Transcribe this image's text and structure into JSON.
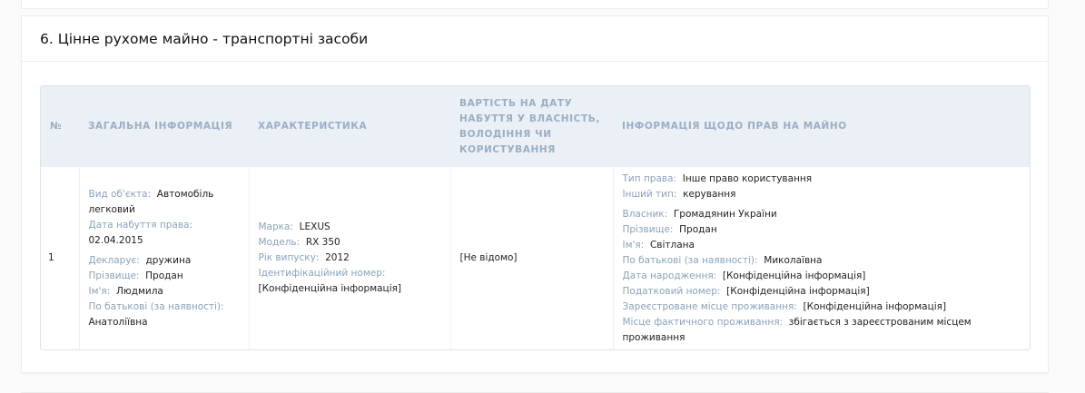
{
  "section": {
    "title": "6. Цінне рухоме майно - транспортні засоби"
  },
  "table": {
    "headers": {
      "no": "№",
      "general": "Загальна інформація",
      "characteristic": "Характеристика",
      "value": "Вартість на дату набуття у власність, володіння чи користування",
      "rights": "Інформація щодо прав на майно"
    },
    "row": {
      "no": "1",
      "general": {
        "object_type_label": "Вид об'єкта:",
        "object_type_value": "Автомобіль легковий",
        "acq_date_label": "Дата набуття права:",
        "acq_date_value": "02.04.2015",
        "declarant_label": "Декларує:",
        "declarant_value": "дружина",
        "surname_label": "Прізвище:",
        "surname_value": "Продан",
        "name_label": "Ім'я:",
        "name_value": "Людмила",
        "patronymic_label": "По батькові (за наявності):",
        "patronymic_value": "Анатоліївна"
      },
      "characteristic": {
        "brand_label": "Марка:",
        "brand_value": "LEXUS",
        "model_label": "Модель:",
        "model_value": "RX 350",
        "year_label": "Рік випуску:",
        "year_value": "2012",
        "vin_label": "Ідентифікаційний номер:",
        "vin_value": "[Конфіденційна інформація]"
      },
      "value": "[Не відомо]",
      "rights": {
        "right_type_label": "Тип права:",
        "right_type_value": "Інше право користування",
        "other_type_label": "Інший тип:",
        "other_type_value": "керування",
        "owner_label": "Власник:",
        "owner_value": "Громадянин України",
        "surname_label": "Прізвище:",
        "surname_value": "Продан",
        "name_label": "Ім'я:",
        "name_value": "Світлана",
        "patronymic_label": "По батькові (за наявності):",
        "patronymic_value": "Миколаївна",
        "birth_label": "Дата народження:",
        "birth_value": "[Конфіденційна інформація]",
        "tax_label": "Податковий номер:",
        "tax_value": "[Конфіденційна інформація]",
        "reg_label": "Зареєстроване місце проживання:",
        "reg_value": "[Конфіденційна інформація]",
        "actual_label": "Місце фактичного проживання:",
        "actual_value": "збігається з зареєстрованим місцем проживання"
      }
    }
  }
}
